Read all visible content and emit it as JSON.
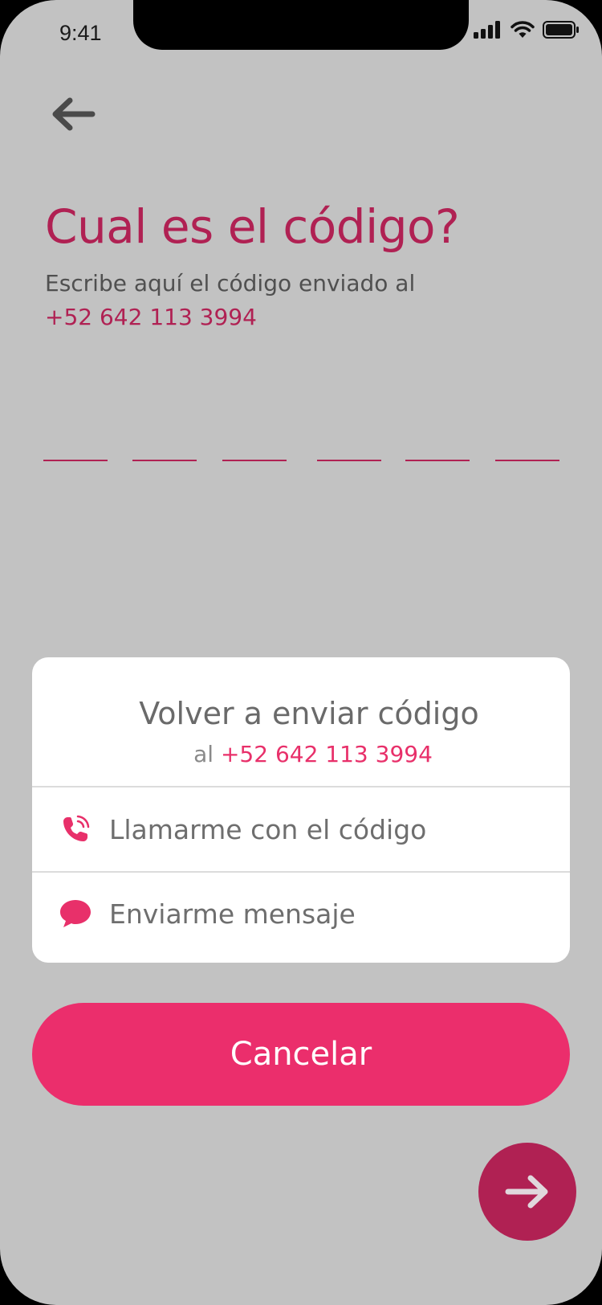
{
  "status_bar": {
    "time": "9:41",
    "icons": [
      "signal-icon",
      "wifi-icon",
      "battery-icon"
    ]
  },
  "header": {
    "back_icon": "arrow-left-icon",
    "title": "Cual es el código?",
    "subtitle": "Escribe aquí el código enviado al",
    "phone": "+52 642 113 3994"
  },
  "code_input": {
    "digits": [
      "",
      "",
      "",
      "",
      "",
      ""
    ]
  },
  "resend_sheet": {
    "title": "Volver a enviar código",
    "prefix": "al",
    "phone": "+52 642 113 3994",
    "options": [
      {
        "icon": "phone-call-icon",
        "label": "Llamarme con el código"
      },
      {
        "icon": "chat-bubble-icon",
        "label": "Enviarme mensaje"
      }
    ]
  },
  "actions": {
    "cancel_label": "Cancelar",
    "next_icon": "arrow-right-icon"
  },
  "colors": {
    "background": "#c2c2c2",
    "accent": "#b02153",
    "primary_button": "#eb2e6c",
    "sheet": "#ffffff"
  }
}
